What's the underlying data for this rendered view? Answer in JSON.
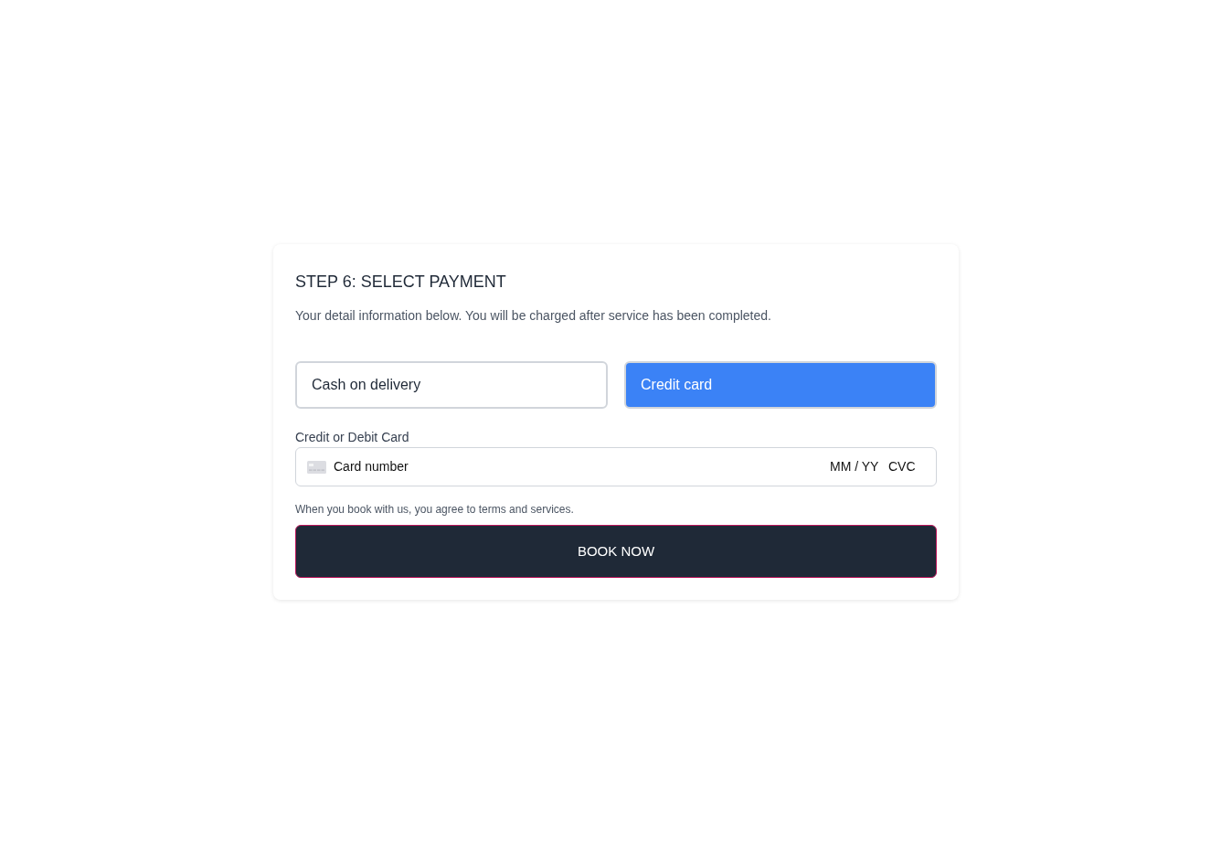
{
  "step_title": "STEP 6: SELECT PAYMENT",
  "description": "Your detail information below. You will be charged after service has been completed.",
  "payment_options": [
    {
      "label": "Cash on delivery",
      "selected": false
    },
    {
      "label": "Credit card",
      "selected": true
    }
  ],
  "card_section": {
    "label": "Credit or Debit Card",
    "card_number": {
      "placeholder": "Card number"
    },
    "expiry": {
      "placeholder": "MM / YY"
    },
    "cvc": {
      "placeholder": "CVC"
    }
  },
  "terms_note": "When you book with us, you agree to terms and services.",
  "submit_button": "BOOK NOW"
}
